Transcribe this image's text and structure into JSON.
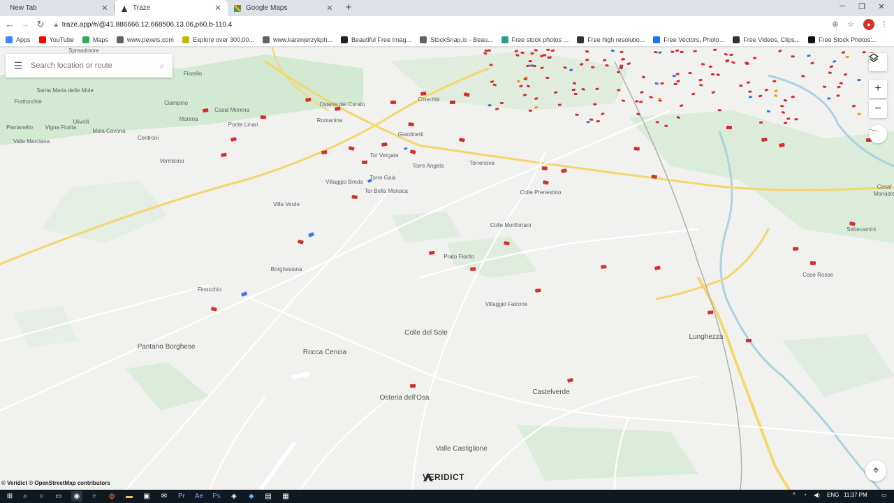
{
  "browser": {
    "tabs": [
      {
        "title": "New Tab",
        "close": "✕"
      },
      {
        "title": "Traze",
        "close": "✕"
      },
      {
        "title": "Google Maps",
        "close": "✕"
      }
    ],
    "new_tab": "+",
    "url": "traze.app/#/@41.886666,12.668506,13.06,p60,b-110.4",
    "profile_initial": "●"
  },
  "bookmarks": [
    {
      "label": "Apps",
      "color": "#4285f4"
    },
    {
      "label": "YouTube",
      "color": "#ff0000"
    },
    {
      "label": "Maps",
      "color": "#34a853"
    },
    {
      "label": "www.pexels.com",
      "color": "#5f6368"
    },
    {
      "label": "Explore over 300,00...",
      "color": "#c9b300"
    },
    {
      "label": "www.karenjerzykph...",
      "color": "#5f6368"
    },
    {
      "label": "Beautiful Free Imag...",
      "color": "#222"
    },
    {
      "label": "StockSnap.io - Beau...",
      "color": "#5f6368"
    },
    {
      "label": "Free stock photos ...",
      "color": "#2a9d8f"
    },
    {
      "label": "Free high resolutio...",
      "color": "#333"
    },
    {
      "label": "Free Vectors, Photo...",
      "color": "#1a73e8"
    },
    {
      "label": "Free Videos, Clips...",
      "color": "#333"
    },
    {
      "label": "Free Stock Photos:...",
      "color": "#111"
    }
  ],
  "map": {
    "search_placeholder": "Search location or route",
    "attribution": "© Veridict © OpenStreetMap contributors",
    "brand": "VERIDICT",
    "zoom_in": "+",
    "zoom_out": "−",
    "places": [
      {
        "name": "Spreadmore",
        "cls": ""
      },
      {
        "name": "Fiorello",
        "cls": ""
      },
      {
        "name": "Santa Maria delle Mole",
        "cls": ""
      },
      {
        "name": "Frattocchie",
        "cls": ""
      },
      {
        "name": "Ciampino",
        "cls": ""
      },
      {
        "name": "Casal Morena",
        "cls": ""
      },
      {
        "name": "Osteria del Curato",
        "cls": ""
      },
      {
        "name": "Cinecittà",
        "cls": ""
      },
      {
        "name": "Pantanello",
        "cls": ""
      },
      {
        "name": "Vigna Fiorita",
        "cls": ""
      },
      {
        "name": "Ulivelli",
        "cls": ""
      },
      {
        "name": "Mola Cavona",
        "cls": ""
      },
      {
        "name": "Morena",
        "cls": ""
      },
      {
        "name": "Ponte Linari",
        "cls": ""
      },
      {
        "name": "Romanina",
        "cls": ""
      },
      {
        "name": "Giardinetti",
        "cls": ""
      },
      {
        "name": "Valle Marciana",
        "cls": ""
      },
      {
        "name": "Centroni",
        "cls": ""
      },
      {
        "name": "Tor Vergata",
        "cls": ""
      },
      {
        "name": "Vermicino",
        "cls": ""
      },
      {
        "name": "Torre Angela",
        "cls": ""
      },
      {
        "name": "Torrenova",
        "cls": ""
      },
      {
        "name": "Torre Gaia",
        "cls": ""
      },
      {
        "name": "Villaggio Breda",
        "cls": ""
      },
      {
        "name": "Tor Bella Monaca",
        "cls": ""
      },
      {
        "name": "Colle Prenestino",
        "cls": ""
      },
      {
        "name": "Villa Verde",
        "cls": ""
      },
      {
        "name": "Colle Monfortani",
        "cls": ""
      },
      {
        "name": "Settecamini",
        "cls": ""
      },
      {
        "name": "Prato Fiorito",
        "cls": ""
      },
      {
        "name": "Borghesiana",
        "cls": ""
      },
      {
        "name": "Case Rosse",
        "cls": ""
      },
      {
        "name": "Finocchio",
        "cls": ""
      },
      {
        "name": "Villaggio Falcone",
        "cls": ""
      },
      {
        "name": "Colle del Sole",
        "cls": "lg"
      },
      {
        "name": "Lunghezza",
        "cls": "lg"
      },
      {
        "name": "Pantano Borghese",
        "cls": "lg"
      },
      {
        "name": "Rocca Cencia",
        "cls": "lg"
      },
      {
        "name": "Osteria dell'Osa",
        "cls": "lg"
      },
      {
        "name": "Castelverde",
        "cls": "lg"
      },
      {
        "name": "Valle Castiglione",
        "cls": "lg"
      },
      {
        "name": "Casal Monaste",
        "cls": ""
      }
    ]
  },
  "taskbar": {
    "lang": "ENG",
    "time": "11:37 PM"
  }
}
